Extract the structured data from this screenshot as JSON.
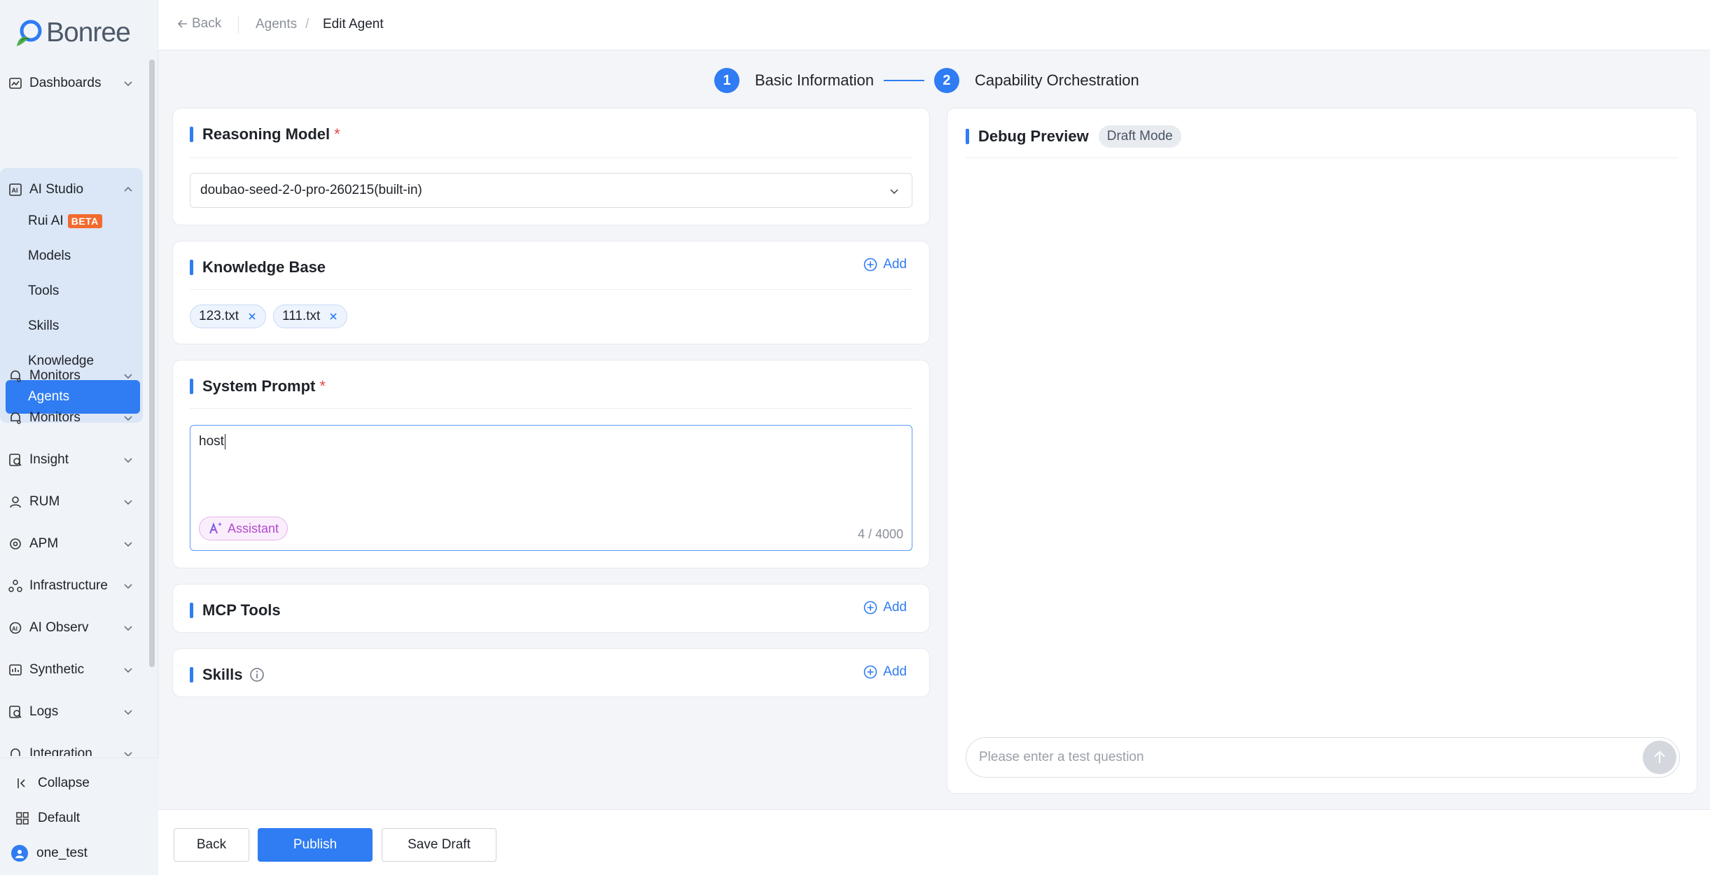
{
  "brand": {
    "name": "Bonree"
  },
  "sidebar": {
    "items": [
      {
        "label": "Dashboards",
        "icon": "dashboard-icon"
      },
      {
        "label": "AI Studio",
        "icon": "ai-studio-icon"
      },
      {
        "label": "Monitors",
        "icon": "monitor-icon"
      },
      {
        "label": "Monitors",
        "icon": "monitor-icon"
      },
      {
        "label": "Insight",
        "icon": "insight-icon"
      },
      {
        "label": "RUM",
        "icon": "rum-icon"
      },
      {
        "label": "APM",
        "icon": "apm-icon"
      },
      {
        "label": "Infrastructure",
        "icon": "infrastructure-icon"
      },
      {
        "label": "AI Observ",
        "icon": "ai-observ-icon"
      },
      {
        "label": "Synthetic",
        "icon": "synthetic-icon"
      },
      {
        "label": "Logs",
        "icon": "logs-icon"
      },
      {
        "label": "Integration",
        "icon": "integration-icon"
      }
    ],
    "ai_studio_sub": [
      {
        "label": "Rui AI",
        "badge": "BETA"
      },
      {
        "label": "Models"
      },
      {
        "label": "Tools"
      },
      {
        "label": "Skills"
      },
      {
        "label": "Knowledge"
      },
      {
        "label": "Agents"
      }
    ],
    "bottom": {
      "collapse": "Collapse",
      "workspace": "Default",
      "user": "one_test"
    }
  },
  "header": {
    "back": "Back",
    "breadcrumb_parent": "Agents",
    "breadcrumb_sep": "/",
    "breadcrumb_current": "Edit Agent"
  },
  "steps": [
    {
      "num": "1",
      "label": "Basic Information"
    },
    {
      "num": "2",
      "label": "Capability Orchestration"
    }
  ],
  "reasoning_model": {
    "title": "Reasoning Model",
    "required": "*",
    "selected": "doubao-seed-2-0-pro-260215(built-in)"
  },
  "knowledge_base": {
    "title": "Knowledge Base",
    "add": "Add",
    "tags": [
      "123.txt",
      "111.txt"
    ]
  },
  "system_prompt": {
    "title": "System Prompt",
    "required": "*",
    "value": "host",
    "assistant": "Assistant",
    "count": "4 / 4000"
  },
  "mcp_tools": {
    "title": "MCP Tools",
    "add": "Add"
  },
  "skills": {
    "title": "Skills",
    "add": "Add"
  },
  "debug": {
    "title": "Debug Preview",
    "badge": "Draft Mode",
    "placeholder": "Please enter a test question"
  },
  "footer": {
    "back": "Back",
    "publish": "Publish",
    "save_draft": "Save Draft"
  },
  "colors": {
    "primary": "#2f7cf3",
    "required": "#e5484d",
    "beta": "#f26a2e",
    "assistant": "#b24ad2"
  }
}
